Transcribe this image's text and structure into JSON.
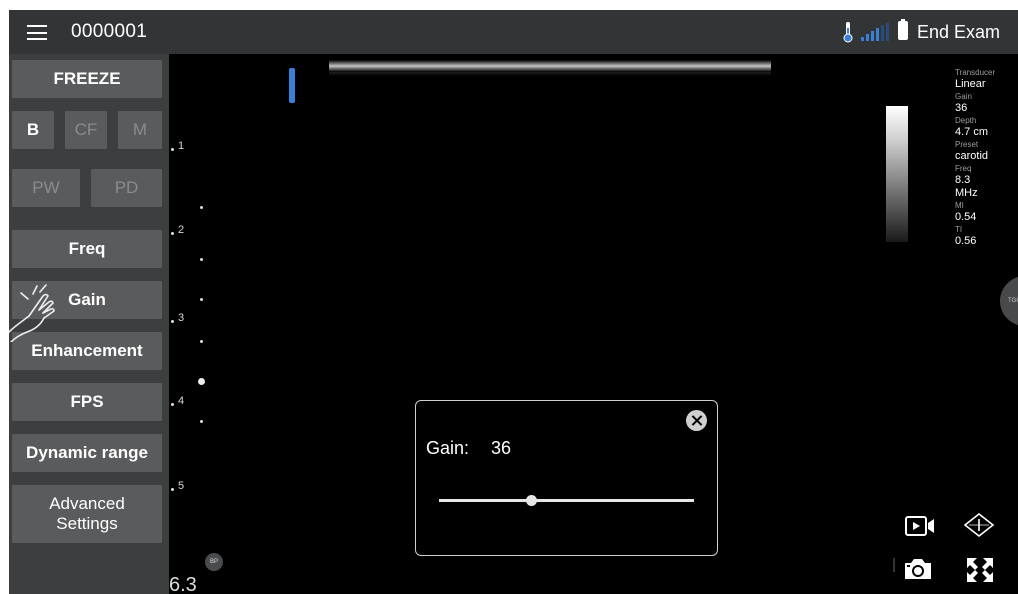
{
  "topbar": {
    "patient_id": "0000001",
    "end_exam_label": "End Exam"
  },
  "sidebar": {
    "freeze_label": "FREEZE",
    "modes": [
      {
        "label": "B",
        "state": "active"
      },
      {
        "label": "CF",
        "state": "dim"
      },
      {
        "label": "M",
        "state": "dim"
      }
    ],
    "doppler_modes": [
      {
        "label": "PW",
        "state": "dim"
      },
      {
        "label": "PD",
        "state": "dim"
      }
    ],
    "freq_label": "Freq",
    "gain_label": "Gain",
    "enhancement_label": "Enhancement",
    "fps_label": "FPS",
    "dynamic_range_label": "Dynamic range",
    "advanced_line1": "Advanced",
    "advanced_line2": "Settings"
  },
  "depth_scale": {
    "marks": [
      "1",
      "2",
      "3",
      "4",
      "5"
    ],
    "bottom_value": "6.3",
    "bp_badge": "BP"
  },
  "parameters": {
    "transducer_key": "Transducer",
    "transducer_val": "Linear",
    "gain_key": "Gain",
    "gain_val": "36",
    "depth_key": "Depth",
    "depth_val": "4.7 cm",
    "preset_key": "Preset",
    "preset_val": "carotid",
    "freq_key": "Freq",
    "freq_val_1": "8.3",
    "freq_val_2": "MHz",
    "mi_key": "MI",
    "mi_val": "0.54",
    "ti_key": "TI",
    "ti_val": "0.56"
  },
  "tgc_tab_label": "TGC",
  "gain_dialog": {
    "label": "Gain:",
    "value": "36",
    "slider_fraction": 0.36
  },
  "icons": {
    "menu": "hamburger-menu-icon",
    "thermometer": "thermometer-icon",
    "signal": "signal-strength-icon",
    "battery": "battery-icon",
    "video": "video-record-icon",
    "probe": "probe-orientation-icon",
    "camera": "camera-icon",
    "expand": "fullscreen-expand-icon"
  },
  "colors": {
    "accent_blue": "#3a7fd6",
    "topbar_bg": "#333436",
    "button_bg": "#5a5b5d"
  }
}
